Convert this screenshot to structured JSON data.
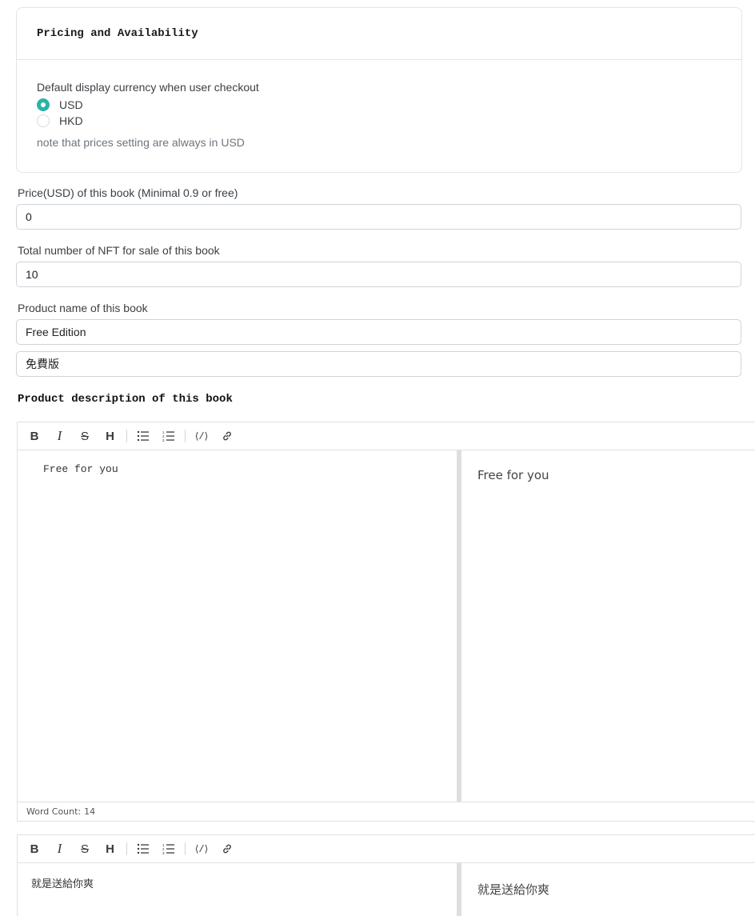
{
  "pricing_card": {
    "title": "Pricing and Availability",
    "currency_label": "Default display currency when user checkout",
    "options": [
      {
        "label": "USD",
        "checked": true
      },
      {
        "label": "HKD",
        "checked": false
      }
    ],
    "note": "note that prices setting are always in USD"
  },
  "price_field": {
    "label": "Price(USD) of this book (Minimal 0.9 or free)",
    "value": "0"
  },
  "nft_count_field": {
    "label": "Total number of NFT for sale of this book",
    "value": "10"
  },
  "product_name_field": {
    "label": "Product name of this book",
    "value_en": "Free Edition",
    "value_zh": "免費版"
  },
  "description_section": {
    "title": "Product description of this book"
  },
  "toolbar": {
    "bold": "B",
    "italic": "I",
    "strike": "S",
    "heading": "H",
    "code": "⟨/⟩"
  },
  "editor_en": {
    "content": "Free for you",
    "preview": "Free for you",
    "word_count_label": "Word Count:",
    "word_count": "14"
  },
  "editor_zh": {
    "content": "就是送給你爽",
    "preview": "就是送給你爽"
  },
  "colors": {
    "accent": "#2ab3a6",
    "border": "#dde0e3"
  }
}
